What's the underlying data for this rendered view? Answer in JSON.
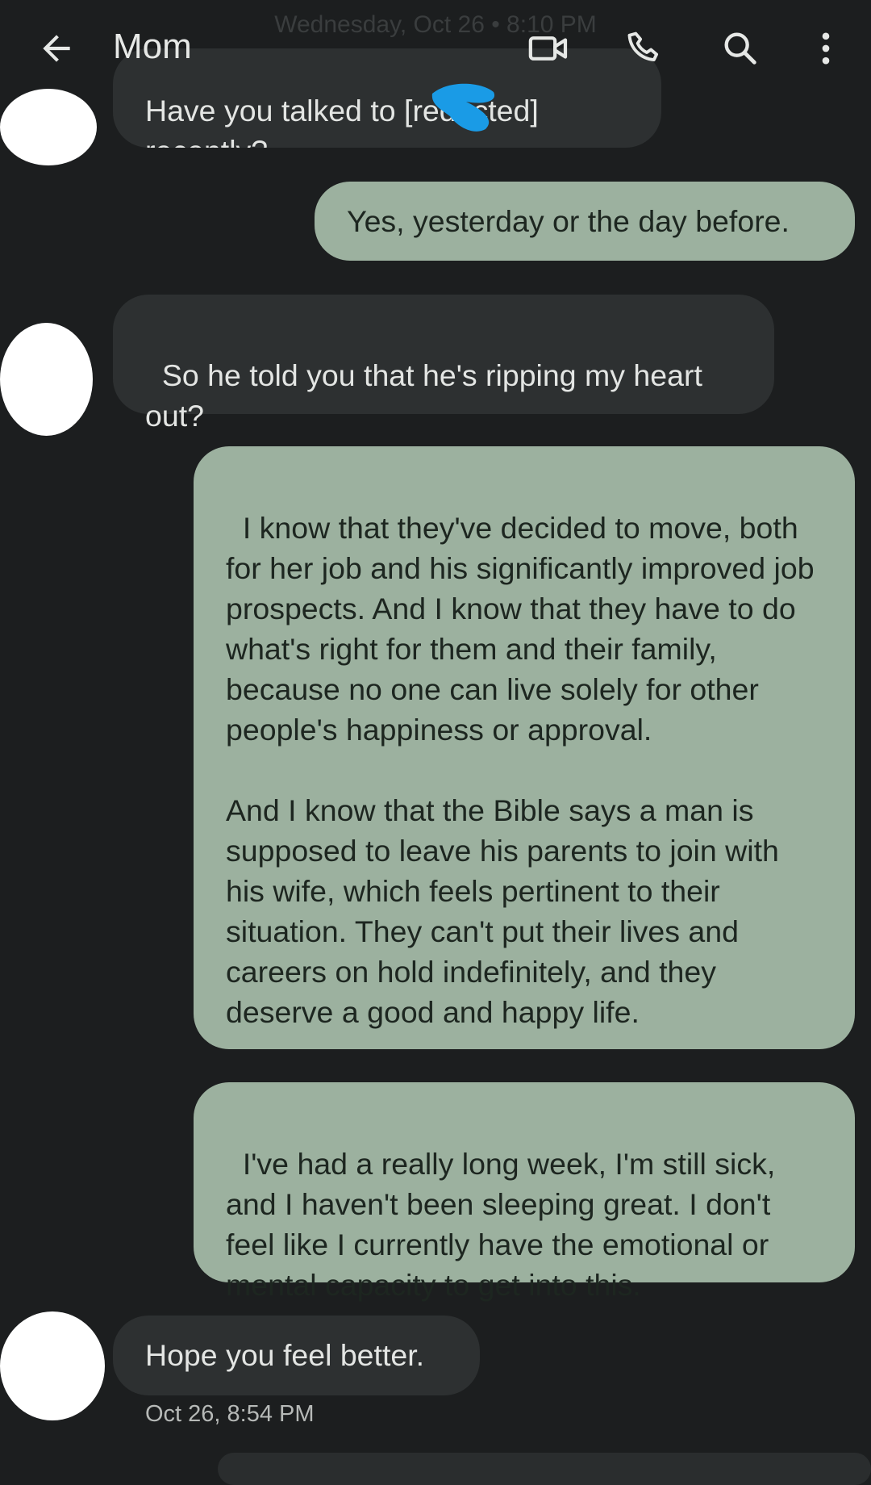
{
  "header": {
    "date_label": "Wednesday, Oct 26 • 8:10 PM",
    "contact_name": "Mom",
    "icons": [
      "back-arrow-icon",
      "video-call-icon",
      "phone-icon",
      "search-icon",
      "more-options-icon"
    ]
  },
  "messages": [
    {
      "direction": "incoming",
      "text": "Have you talked to [redacted] recently?"
    },
    {
      "direction": "outgoing",
      "text": "Yes, yesterday or the day before."
    },
    {
      "direction": "incoming",
      "text": "So he told you that he's ripping my heart out?"
    },
    {
      "direction": "outgoing",
      "text": "I know that they've decided to move, both for her job and his significantly improved job prospects. And I know that they have to do what's right for them and their family, because no one can live solely for other people's happiness or approval.\n\nAnd I know that the Bible says a man is supposed to leave his parents to join with his wife, which feels pertinent to their situation. They can't put their lives and careers on hold indefinitely, and they deserve a good and happy life."
    },
    {
      "direction": "outgoing",
      "text": "I've had a really long week, I'm still sick, and I haven't been sleeping great. I don't feel like I currently have the emotional or mental capacity to get into this."
    },
    {
      "direction": "incoming",
      "text": "Hope you feel better.",
      "timestamp": "Oct 26, 8:54 PM"
    }
  ],
  "colors": {
    "background": "#1c1e1f",
    "incoming_bubble": "#2d3031",
    "outgoing_bubble": "#9cb19f",
    "redaction_mark": "#1a9be6"
  }
}
